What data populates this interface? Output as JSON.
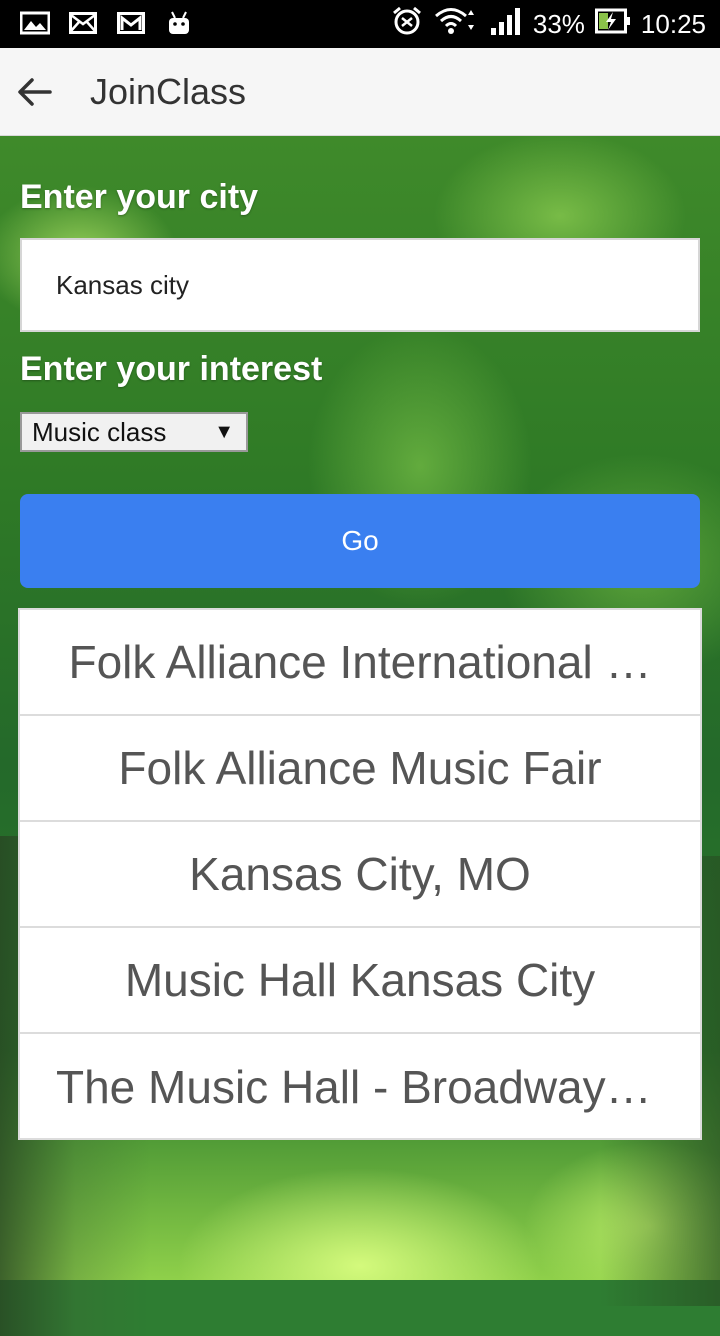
{
  "status_bar": {
    "left_icons": [
      "image-icon",
      "mail-icon",
      "gmail-icon",
      "android-icon"
    ],
    "right_icons": [
      "alarm-icon",
      "wifi-icon",
      "signal-icon",
      "battery-charging-icon"
    ],
    "battery": "33%",
    "time": "10:25"
  },
  "app_bar": {
    "title": "JoinClass",
    "back_icon": "arrow-back-icon"
  },
  "form": {
    "city_label": "Enter your city",
    "city_value": "Kansas city",
    "interest_label": "Enter your interest",
    "interest_selected": "Music class",
    "go_label": "Go"
  },
  "results": [
    {
      "label": "Folk Alliance International …"
    },
    {
      "label": "Folk Alliance Music Fair"
    },
    {
      "label": "Kansas City, MO"
    },
    {
      "label": "Music Hall Kansas City"
    },
    {
      "label": "The Music Hall - Broadway …"
    }
  ],
  "colors": {
    "accent": "#3a7ff0",
    "appbar": "#f6f6f6",
    "status_bar": "#000000"
  }
}
